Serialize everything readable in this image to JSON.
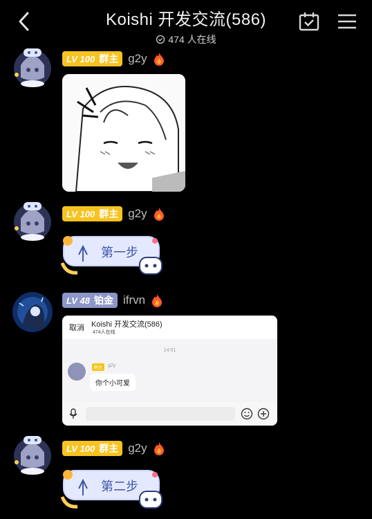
{
  "header": {
    "title": "Koishi 开发交流(586)",
    "online_text": "474 人在线"
  },
  "messages": [
    {
      "badge_level": "LV 100",
      "badge_role": "群主",
      "badge_color": "#f7c320",
      "username": "g2y",
      "content_type": "sticker-image"
    },
    {
      "badge_level": "LV 100",
      "badge_role": "群主",
      "badge_color": "#f7c320",
      "username": "g2y",
      "step_text": "第一步"
    },
    {
      "badge_level": "LV 48",
      "badge_role": "铂金",
      "badge_color": "#8d96c9",
      "username": "ifrvn"
    },
    {
      "badge_level": "LV 100",
      "badge_role": "群主",
      "badge_color": "#f7c320",
      "username": "g2y",
      "step_text": "第二步"
    }
  ],
  "nested_screenshot": {
    "cancel_label": "取消",
    "title": "Koishi 开发交流(586)",
    "online_text": "474人在线",
    "time": "14:51",
    "sender_badge": "群主",
    "sender_name": "g2y",
    "message": "你个小可爱"
  }
}
